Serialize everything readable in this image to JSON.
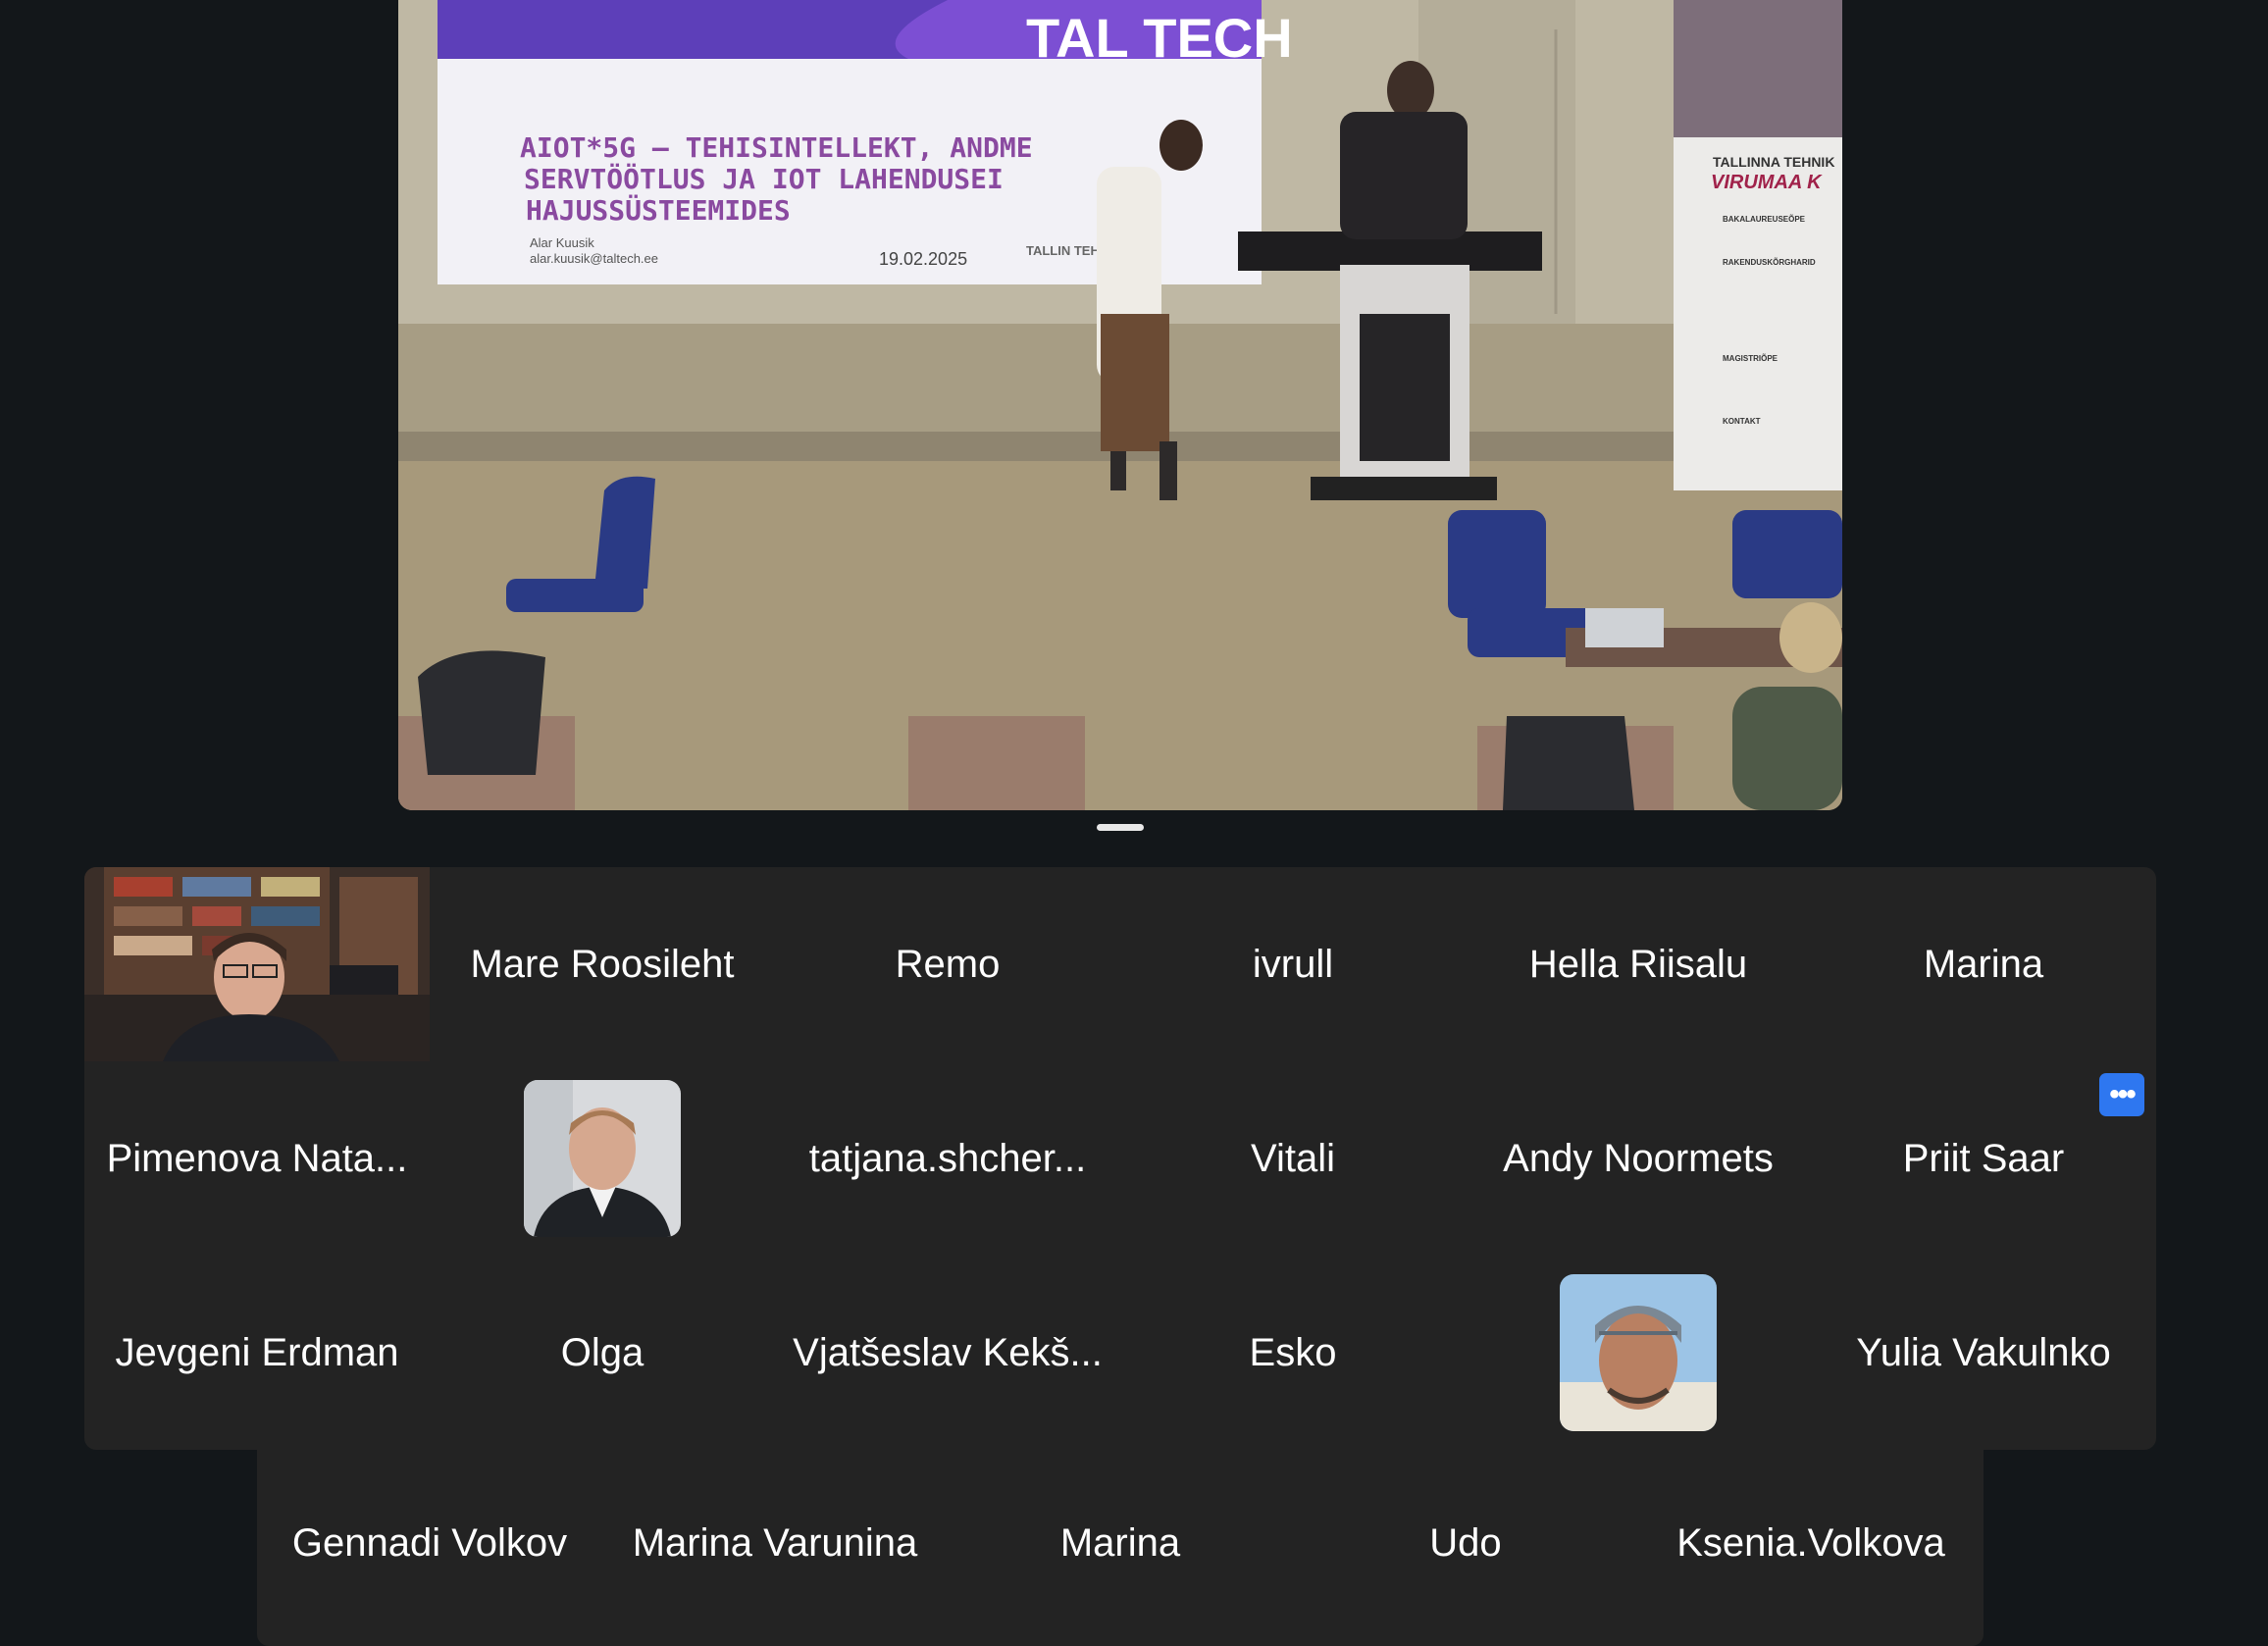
{
  "stage": {
    "slide": {
      "logo": "TAL TECH",
      "title_line1": "AIOT*5G – TEHISINTELLEKT, ANDME",
      "title_line2": "SERVTÖÖTLUS JA IOT LAHENDUSEI",
      "title_line3": "HAJUSSÜSTEEMIDES",
      "author": "Alar Kuusik",
      "email": "alar.kuusik@taltech.ee",
      "date": "19.02.2025",
      "org": "TALLIN TEHNI"
    },
    "banner": {
      "line1": "TALLINNA TEHNIK",
      "line2": "VIRUMAA K",
      "items": [
        "BAKALAUREUSEÕPE",
        "RAKENDUSKÕRGHARID",
        "MAGISTRIÕPE",
        "KONTAKT"
      ]
    }
  },
  "participants": {
    "row1": [
      "Mare Roosileht",
      "Remo",
      "ivrull",
      "Hella Riisalu",
      "Marina"
    ],
    "row2": [
      "Pimenova Nata...",
      "tatjana.shcher...",
      "Vitali",
      "Andy Noormets",
      "Priit Saar"
    ],
    "row3": [
      "Jevgeni Erdman",
      "Olga",
      "Vjatšeslav Kekš...",
      "Esko",
      "Yulia Vakulnko"
    ],
    "row4": [
      "Gennadi Volkov",
      "Marina Varunina",
      "Marina",
      "Udo",
      "Ksenia.Volkova"
    ]
  },
  "more_button_label": "•••",
  "colors": {
    "background": "#13171a",
    "gallery": "#232323",
    "accent": "#2e77f0",
    "text": "#ffffff"
  }
}
